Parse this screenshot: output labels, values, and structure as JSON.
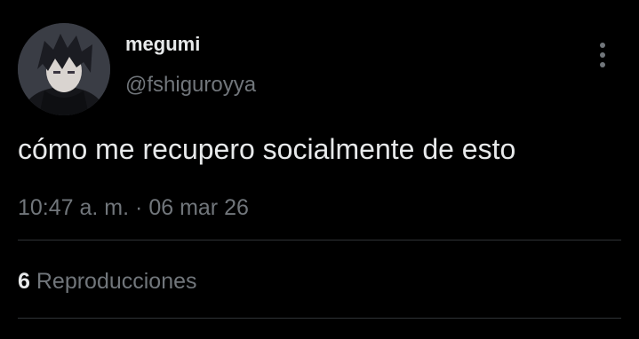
{
  "author": {
    "display_name": "megumi",
    "handle": "@fshiguroyya",
    "avatar": "anime-character-avatar"
  },
  "tweet": {
    "text": "cómo me recupero socialmente de esto",
    "time": "10:47 a. m.",
    "separator": "·",
    "date": "06 mar 26"
  },
  "stats": {
    "views_count": "6",
    "views_label": "Reproducciones"
  },
  "icons": {
    "more": "vertical-ellipsis-icon"
  },
  "colors": {
    "background": "#000000",
    "primary_text": "#e7e9ea",
    "secondary_text": "#71767b",
    "divider": "#2f3336"
  }
}
